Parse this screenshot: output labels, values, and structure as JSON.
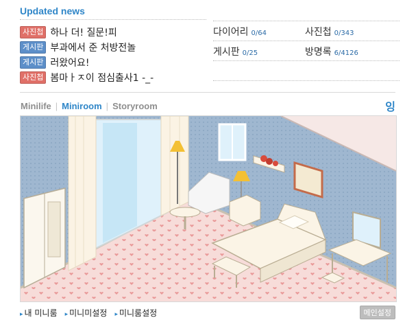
{
  "header": {
    "title": "Updated news"
  },
  "news": [
    {
      "tag": "사진첩",
      "color": "#e07068",
      "text": "하나 더! 질문!피"
    },
    {
      "tag": "게시판",
      "color": "#5d8fc9",
      "text": "부과에서 준 처방전놀"
    },
    {
      "tag": "게시판",
      "color": "#5d8fc9",
      "text": "러왔어요!"
    },
    {
      "tag": "사진첩",
      "color": "#e07068",
      "text": "봄마ㅏㅈ이 점심출사1 -_-"
    }
  ],
  "stats": [
    {
      "label": "다이어리",
      "count": "0/64"
    },
    {
      "label": "사진첩",
      "count": "0/343"
    },
    {
      "label": "게시판",
      "count": "0/25"
    },
    {
      "label": "방명록",
      "count": "6/4126"
    }
  ],
  "tabs": [
    {
      "label": "Minilife",
      "active": false
    },
    {
      "label": "Miniroom",
      "active": true
    },
    {
      "label": "Storyroom",
      "active": false
    }
  ],
  "tab_separator": "|",
  "corner_glyph": "잉",
  "bottom_links": [
    "내 미니룸",
    "미니미설정",
    "미니룸설정"
  ],
  "bottom_link_marker": "▸",
  "main_settings_button": "메인설정",
  "colors": {
    "accent": "#2f86c8",
    "wall": "#9fb7d0",
    "floor": "#f7dcd9",
    "heart": "#e99a9a"
  }
}
